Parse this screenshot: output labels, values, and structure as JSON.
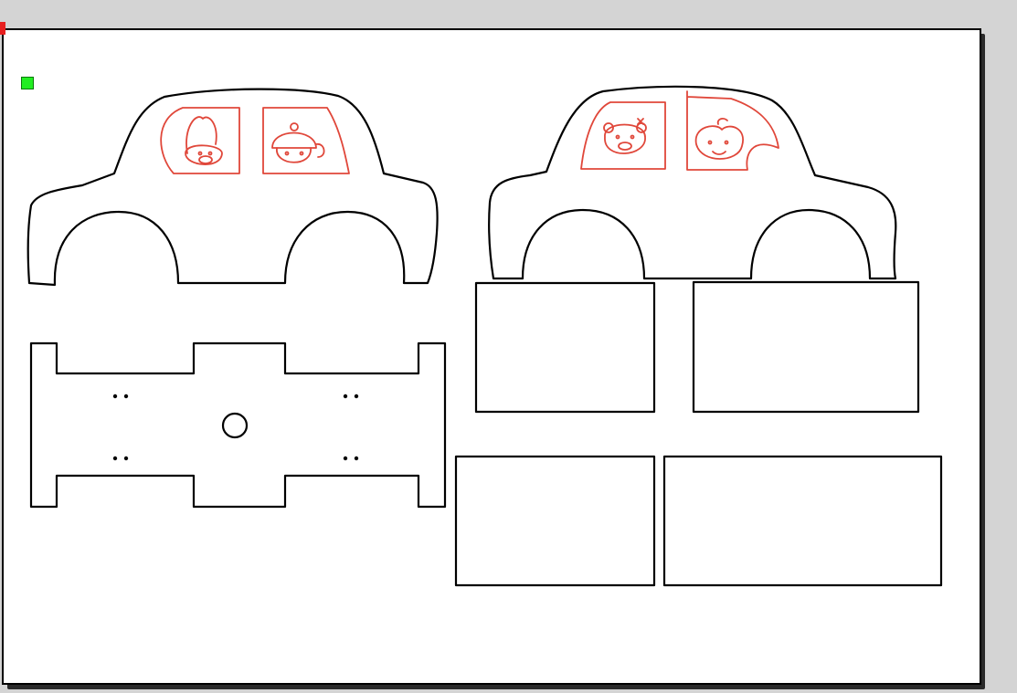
{
  "canvas": {
    "page_color": "#ffffff",
    "outline_color": "#000000",
    "sketch_color": "#e0473a",
    "markers": [
      {
        "name": "red-marker",
        "color": "#e82020"
      },
      {
        "name": "green-marker",
        "color": "#22ee22"
      }
    ]
  },
  "drawing": {
    "pieces": [
      {
        "name": "car-side-left",
        "kind": "car body outline with two window sketches"
      },
      {
        "name": "car-side-right",
        "kind": "car body outline with two window sketches"
      },
      {
        "name": "chassis-base",
        "kind": "rectangle with four wheel cut-outs, four dot pairs and a center hole"
      },
      {
        "name": "panel-1"
      },
      {
        "name": "panel-2"
      },
      {
        "name": "panel-3"
      },
      {
        "name": "panel-4"
      }
    ],
    "icons": [
      "rabbit-face-icon",
      "mushroom-face-icon",
      "bear-face-icon",
      "apple-face-icon"
    ]
  }
}
